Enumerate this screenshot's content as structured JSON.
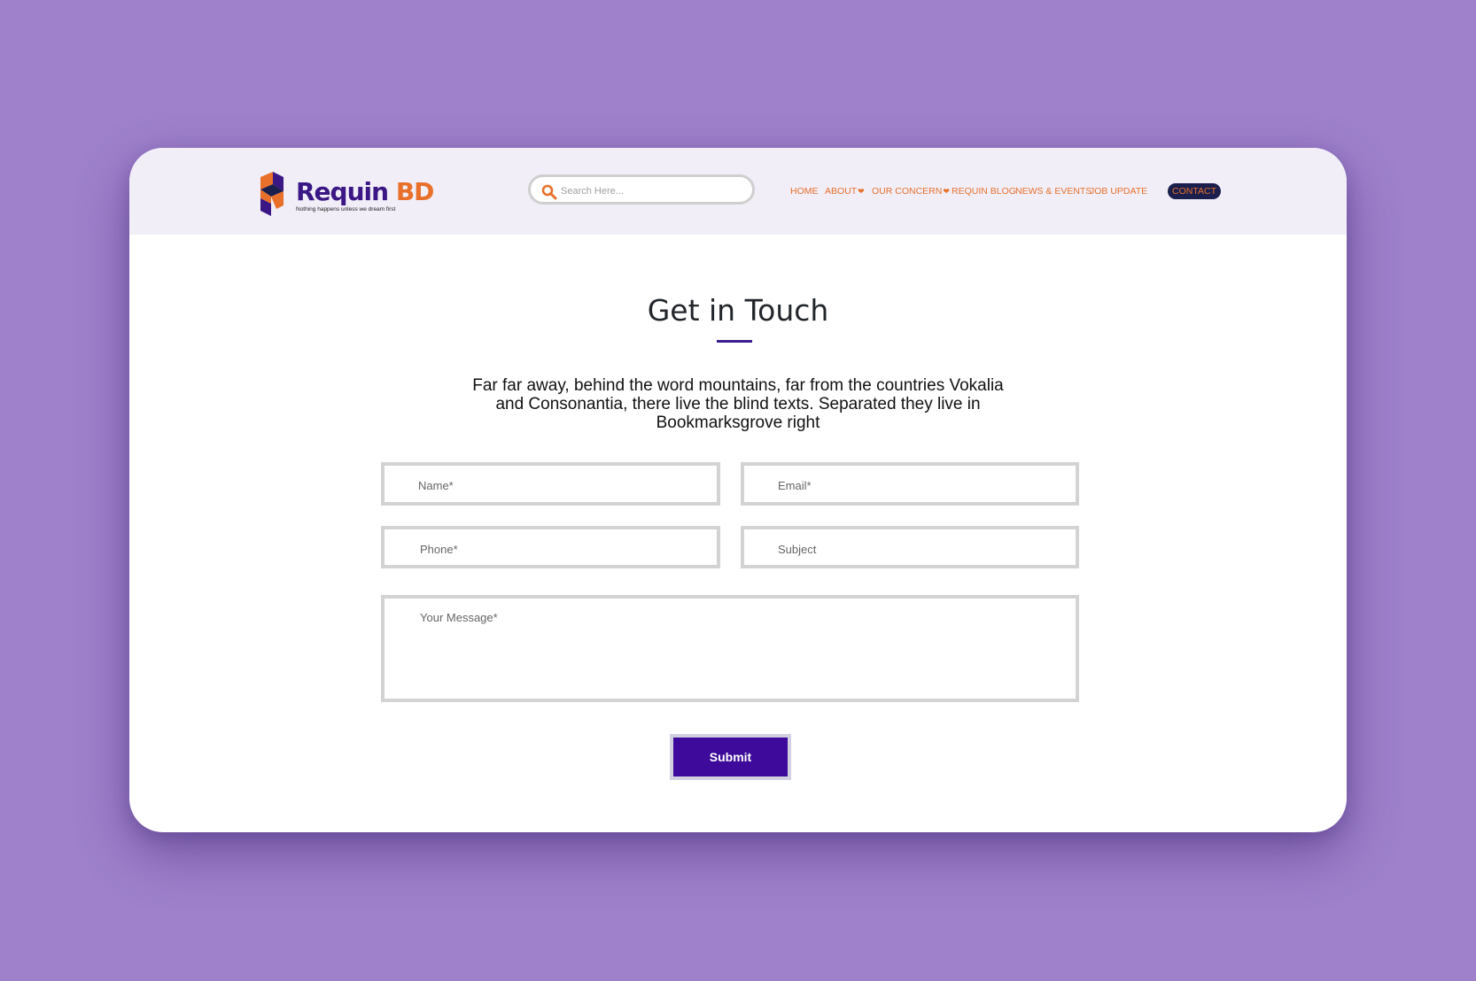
{
  "brand": {
    "name_part1": "Requin",
    "name_part2": "BD",
    "tagline": "Nothing happens unless we dream first",
    "primary_color": "#3a1785",
    "accent_color": "#e8702a"
  },
  "search": {
    "placeholder": "Search Here...",
    "icon": "search-icon"
  },
  "nav": {
    "items": [
      {
        "label": "HOME",
        "dropdown": false
      },
      {
        "label": "ABOUT",
        "dropdown": true
      },
      {
        "label": "OUR CONCERN",
        "dropdown": true
      },
      {
        "label": "REQUIN BLOG",
        "dropdown": false
      },
      {
        "label": "NEWS & EVENTS",
        "dropdown": false
      },
      {
        "label": "JOB UPDATE",
        "dropdown": false
      }
    ],
    "dropdown_icon": "heart-icon",
    "contact_label": "CONTACT"
  },
  "main": {
    "title": "Get in Touch",
    "description": "Far far away, behind the word mountains, far from the countries Vokalia and Consonantia, there live the blind texts. Separated they live in Bookmarksgrove right"
  },
  "form": {
    "name_placeholder": "Name*",
    "email_placeholder": "Email*",
    "phone_placeholder": "Phone*",
    "subject_placeholder": "Subject",
    "message_placeholder": "Your Message*",
    "submit_label": "Submit",
    "submit_color": "#3d0a9b"
  }
}
